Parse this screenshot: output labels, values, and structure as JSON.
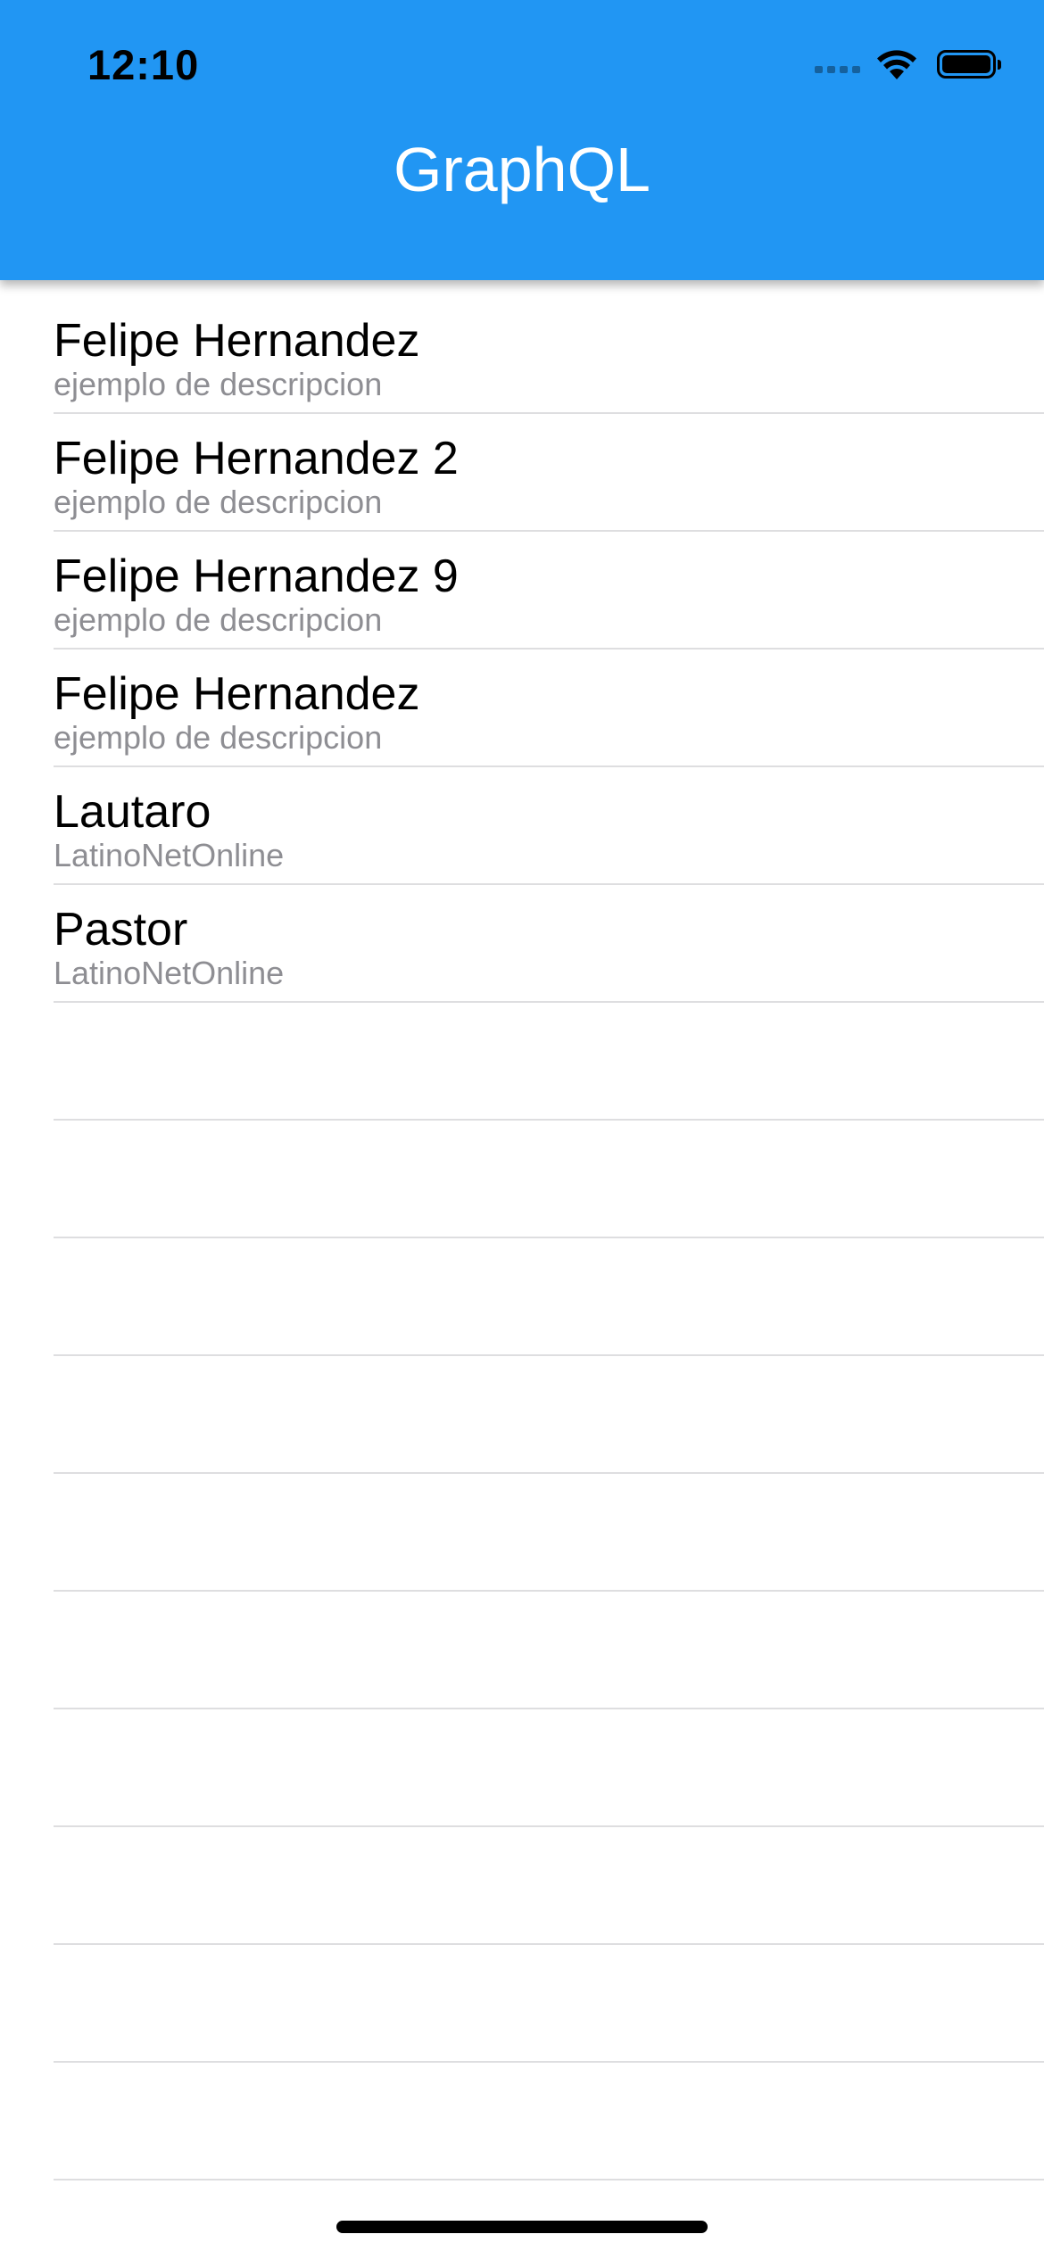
{
  "status_bar": {
    "time": "12:10",
    "signal_icon": "cellular-signal-icon",
    "wifi_icon": "wifi-icon",
    "battery_icon": "battery-icon"
  },
  "header": {
    "title": "GraphQL",
    "background_color": "#2196F3"
  },
  "list": {
    "items": [
      {
        "title": "Felipe Hernandez",
        "subtitle": "ejemplo de descripcion"
      },
      {
        "title": "Felipe Hernandez 2",
        "subtitle": "ejemplo de descripcion"
      },
      {
        "title": "Felipe Hernandez 9",
        "subtitle": "ejemplo de descripcion"
      },
      {
        "title": "Felipe Hernandez",
        "subtitle": "ejemplo de descripcion"
      },
      {
        "title": "Lautaro",
        "subtitle": "LatinoNetOnline"
      },
      {
        "title": "Pastor",
        "subtitle": "LatinoNetOnline"
      }
    ],
    "empty_rows": 10
  },
  "colors": {
    "subtitle": "#8e8e93",
    "divider": "#dedee0"
  }
}
